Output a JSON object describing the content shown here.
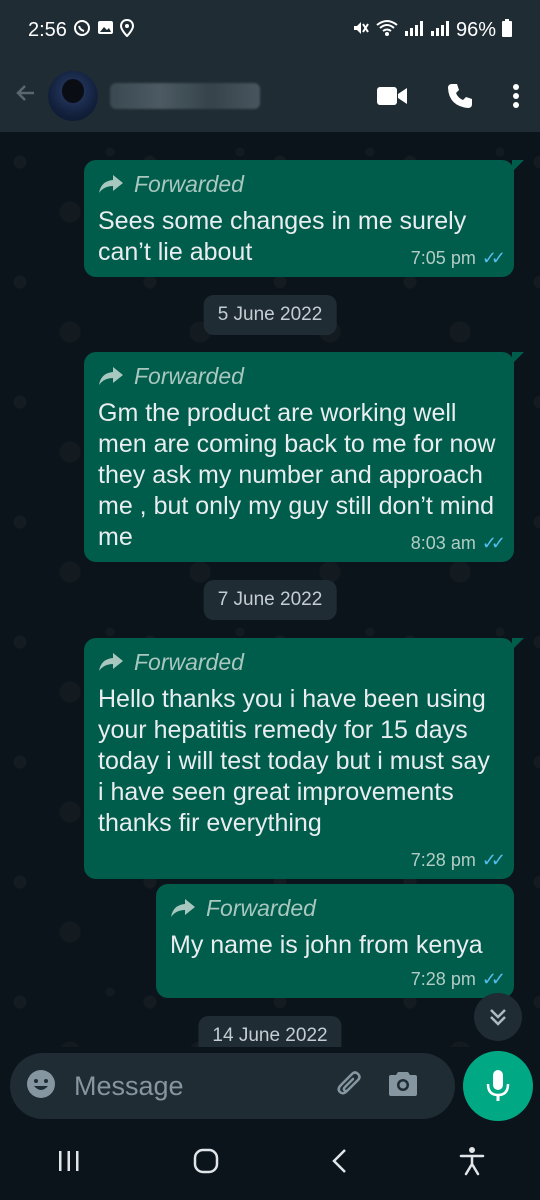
{
  "status_bar": {
    "time": "2:56",
    "battery": "96%"
  },
  "header": {
    "contact_name": "",
    "icons": [
      "back-arrow-icon",
      "video-call-icon",
      "voice-call-icon",
      "more-options-icon"
    ]
  },
  "chat": {
    "forwarded_label": "Forwarded",
    "dates": [
      "5 June 2022",
      "7 June 2022",
      "14 June 2022"
    ],
    "messages": [
      {
        "text": "Sees some changes in me surely can’t lie about",
        "time": "7:05 pm",
        "forwarded": true,
        "status": "read"
      },
      {
        "text": "Gm the product are working well men are coming back to me for now they ask my number and approach me , but only my guy still don’t mind me",
        "time": "8:03 am",
        "forwarded": true,
        "status": "read"
      },
      {
        "text": "Hello thanks you i have been using your hepatitis remedy for 15 days today i will test today but i must say i have seen great improvements thanks fir everything",
        "time": "7:28 pm",
        "forwarded": true,
        "status": "read"
      },
      {
        "text": "My name is john from kenya",
        "time": "7:28 pm",
        "forwarded": true,
        "status": "read"
      }
    ]
  },
  "composer": {
    "placeholder": "Message"
  },
  "colors": {
    "background": "#0b141a",
    "bubble_outgoing": "#005c4b",
    "accent": "#00a884",
    "read_ticks": "#53bdeb"
  }
}
